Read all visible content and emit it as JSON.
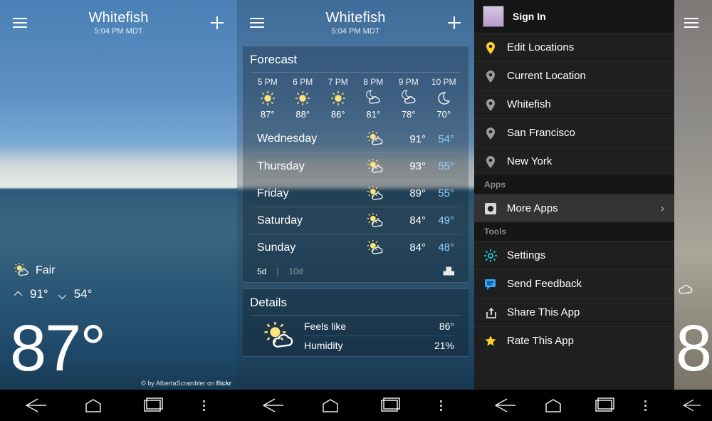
{
  "header": {
    "city": "Whitefish",
    "time": "5:04 PM MDT"
  },
  "screen1": {
    "condition": "Fair",
    "high": "91°",
    "low": "54°",
    "temp": "87°",
    "credit_prefix": "© by AlbertaScrambler on ",
    "credit_brand": "flickr"
  },
  "screen2": {
    "forecast_title": "Forecast",
    "hourly": [
      {
        "t": "5 PM",
        "d": "87°",
        "ic": "sun"
      },
      {
        "t": "6 PM",
        "d": "88°",
        "ic": "sun"
      },
      {
        "t": "7 PM",
        "d": "86°",
        "ic": "sun"
      },
      {
        "t": "8 PM",
        "d": "81°",
        "ic": "mooncloud"
      },
      {
        "t": "9 PM",
        "d": "78°",
        "ic": "mooncloud"
      },
      {
        "t": "10 PM",
        "d": "70°",
        "ic": "moon"
      }
    ],
    "daily": [
      {
        "n": "Wednesday",
        "hi": "91°",
        "lo": "54°"
      },
      {
        "n": "Thursday",
        "hi": "93°",
        "lo": "55°"
      },
      {
        "n": "Friday",
        "hi": "89°",
        "lo": "55°"
      },
      {
        "n": "Saturday",
        "hi": "84°",
        "lo": "49°"
      },
      {
        "n": "Sunday",
        "hi": "84°",
        "lo": "48°"
      }
    ],
    "toggle_5d": "5d",
    "toggle_10d": "10d",
    "details_title": "Details",
    "feels_label": "Feels like",
    "feels_value": "86°",
    "humidity_label": "Humidity",
    "humidity_value": "21%"
  },
  "drawer": {
    "sign_in": "Sign In",
    "locations": [
      {
        "label": "Edit Locations",
        "pin": "y"
      },
      {
        "label": "Current Location",
        "pin": "g"
      },
      {
        "label": "Whitefish",
        "pin": "g"
      },
      {
        "label": "San Francisco",
        "pin": "g"
      },
      {
        "label": "New York",
        "pin": "g"
      }
    ],
    "apps_label": "Apps",
    "more_apps": "More Apps",
    "tools_label": "Tools",
    "tools": [
      {
        "label": "Settings",
        "ic": "gear",
        "color": "#17c0c7"
      },
      {
        "label": "Send Feedback",
        "ic": "chat",
        "color": "#2aa3ff"
      },
      {
        "label": "Share This App",
        "ic": "share",
        "color": "#d7d7d7"
      },
      {
        "label": "Rate This App",
        "ic": "star",
        "color": "#ffcf2e"
      }
    ]
  },
  "screen4": {
    "temp": "8"
  }
}
